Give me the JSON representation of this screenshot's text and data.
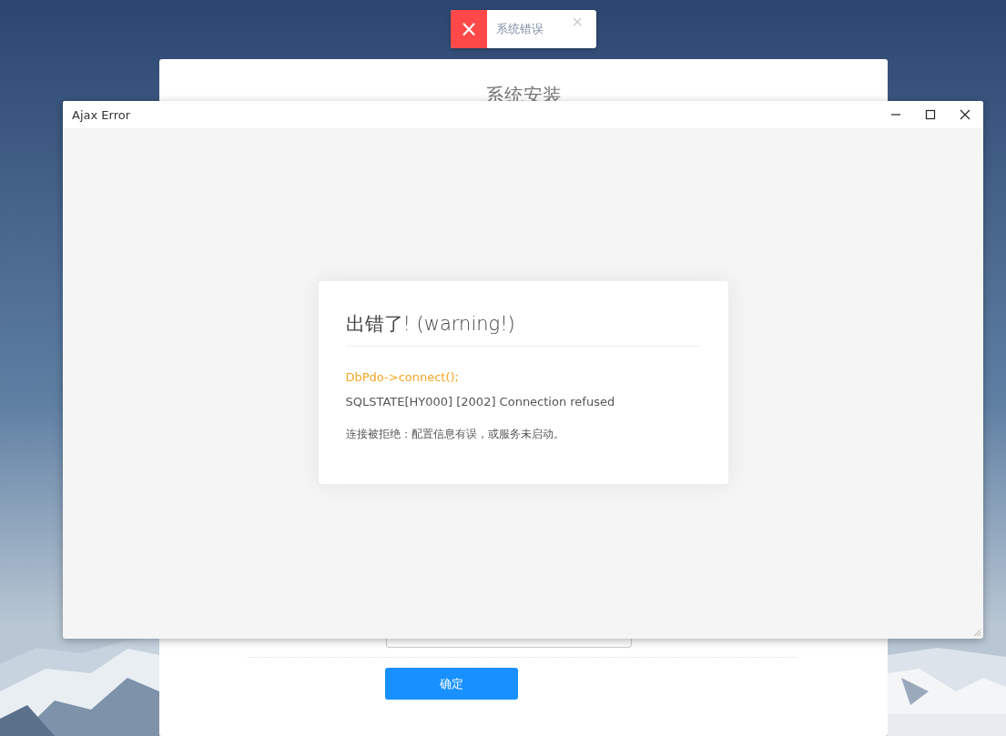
{
  "install_panel": {
    "title": "系统安装",
    "buttons": [
      {
        "label": "确定"
      }
    ]
  },
  "toast": {
    "icon": "×",
    "message": "系统错误",
    "close": "×"
  },
  "dialog": {
    "title": "Ajax Error",
    "error": {
      "heading": "出错了! (warning!)",
      "call": "DbPdo->connect();",
      "message": "SQLSTATE[HY000] [2002] Connection refused",
      "hint": "连接被拒绝：配置信息有误，或服务未启动。"
    }
  }
}
